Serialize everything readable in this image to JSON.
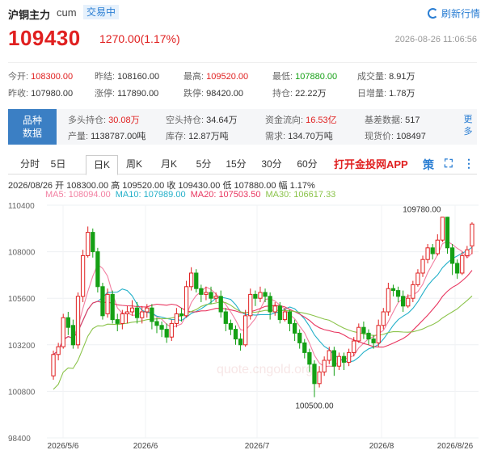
{
  "header": {
    "title": "沪铜主力",
    "code": "cum",
    "status": "交易中",
    "refresh_label": "刷新行情"
  },
  "quote": {
    "price": "109430",
    "change": "1270.00(1.17%)",
    "timestamp": "2026-08-26 11:06:56"
  },
  "stats": {
    "row1": [
      {
        "label": "今开:",
        "value": "108300.00",
        "tone": "red"
      },
      {
        "label": "昨结:",
        "value": "108160.00",
        "tone": "dark"
      },
      {
        "label": "最高:",
        "value": "109520.00",
        "tone": "red"
      },
      {
        "label": "最低:",
        "value": "107880.00",
        "tone": "green"
      },
      {
        "label": "成交量:",
        "value": "8.91万",
        "tone": "dark"
      }
    ],
    "row2": [
      {
        "label": "昨收:",
        "value": "107980.00",
        "tone": "dark"
      },
      {
        "label": "涨停:",
        "value": "117890.00",
        "tone": "dark"
      },
      {
        "label": "跌停:",
        "value": "98420.00",
        "tone": "dark"
      },
      {
        "label": "持仓:",
        "value": "22.22万",
        "tone": "dark"
      },
      {
        "label": "日增量:",
        "value": "1.78万",
        "tone": "dark"
      }
    ]
  },
  "info": {
    "variety_label_1": "品种",
    "variety_label_2": "数据",
    "row1": [
      {
        "label": "多头持仓:",
        "value": "30.08万",
        "tone": "red"
      },
      {
        "label": "空头持仓:",
        "value": "34.64万",
        "tone": "dark"
      },
      {
        "label": "资金流向:",
        "value": "16.53亿",
        "tone": "red"
      },
      {
        "label": "基差数据:",
        "value": "517",
        "tone": "dark"
      }
    ],
    "row2": [
      {
        "label": "产量:",
        "value": "1138787.00吨",
        "tone": "dark"
      },
      {
        "label": "库存:",
        "value": "12.87万吨",
        "tone": "dark"
      },
      {
        "label": "需求:",
        "value": "134.70万吨",
        "tone": "dark"
      },
      {
        "label": "现货价:",
        "value": "108497",
        "tone": "dark"
      }
    ],
    "more_label_1": "更",
    "more_label_2": "多"
  },
  "tabs": [
    "分时",
    "5日",
    "日K",
    "周K",
    "月K",
    "5分",
    "15分",
    "30分",
    "60分"
  ],
  "active_tab": "日K",
  "app_link": "打开金投网APP",
  "ohlc": "2026/08/26  开 108300.00  高 109520.00  收 109430.00  低 107880.00  幅 1.17%",
  "ma": [
    {
      "label": "MA5: 108094.00",
      "color": "#f27fa1"
    },
    {
      "label": "MA10: 107989.00",
      "color": "#23b0c9"
    },
    {
      "label": "MA20: 107503.50",
      "color": "#e8355f"
    },
    {
      "label": "MA30: 106617.33",
      "color": "#8bc34a"
    }
  ],
  "watermark": "quote.cngold.org",
  "chart_data": {
    "type": "candlestick",
    "y_ticks": [
      "110400",
      "108000",
      "105600",
      "103200",
      "100800",
      "98400"
    ],
    "ylim": [
      98400,
      110400
    ],
    "x_ticks": [
      "2026/5/6",
      "2026/6",
      "2026/7",
      "2026/8",
      "2026/8/26"
    ],
    "annotations": [
      "109780.00",
      "100500.00"
    ],
    "colors": {
      "up": "#e02020",
      "down": "#15a015"
    },
    "candles": [
      [
        101600,
        102700,
        101400,
        102900
      ],
      [
        102700,
        103100,
        102400,
        103300
      ],
      [
        103100,
        104600,
        103000,
        104800
      ],
      [
        104600,
        104100,
        103700,
        104900
      ],
      [
        104200,
        103200,
        103000,
        104500
      ],
      [
        103200,
        105700,
        103000,
        105900
      ],
      [
        105700,
        107800,
        105400,
        108100
      ],
      [
        107800,
        109000,
        107700,
        109300
      ],
      [
        109000,
        108000,
        107700,
        109200
      ],
      [
        108000,
        106200,
        105900,
        108200
      ],
      [
        106200,
        104700,
        104500,
        106400
      ],
      [
        104800,
        105800,
        104600,
        106100
      ],
      [
        105800,
        104500,
        104300,
        106000
      ],
      [
        104500,
        104300,
        103900,
        104800
      ],
      [
        104300,
        104800,
        104000,
        105000
      ],
      [
        104800,
        104900,
        104300,
        105200
      ],
      [
        104900,
        105100,
        104700,
        105500
      ],
      [
        105100,
        104600,
        104300,
        105400
      ],
      [
        104600,
        104900,
        104300,
        105200
      ],
      [
        104900,
        105100,
        104600,
        105300
      ],
      [
        105100,
        104400,
        104000,
        105300
      ],
      [
        104400,
        104200,
        103800,
        104600
      ],
      [
        104200,
        104000,
        103600,
        104400
      ],
      [
        104000,
        103600,
        103300,
        104300
      ],
      [
        103600,
        104300,
        103400,
        104500
      ],
      [
        104300,
        104800,
        104100,
        105100
      ],
      [
        104800,
        104700,
        104400,
        105100
      ],
      [
        104700,
        106200,
        104600,
        106500
      ],
      [
        106200,
        106900,
        106000,
        107200
      ],
      [
        106900,
        106100,
        105900,
        107100
      ],
      [
        106100,
        105800,
        105400,
        106300
      ],
      [
        105800,
        105900,
        105500,
        106200
      ],
      [
        105900,
        105600,
        105300,
        106200
      ],
      [
        105600,
        105700,
        105400,
        105900
      ],
      [
        105700,
        104900,
        104600,
        106000
      ],
      [
        104900,
        104300,
        103900,
        105100
      ],
      [
        104300,
        104000,
        103700,
        104500
      ],
      [
        104000,
        103500,
        103200,
        104200
      ],
      [
        103500,
        103200,
        102900,
        103800
      ],
      [
        103200,
        104700,
        103100,
        105000
      ],
      [
        104700,
        105800,
        104500,
        106100
      ],
      [
        105800,
        105600,
        105200,
        106000
      ],
      [
        105600,
        105900,
        105400,
        106200
      ],
      [
        105900,
        105700,
        105400,
        106100
      ],
      [
        105700,
        104900,
        104500,
        105900
      ],
      [
        104900,
        105200,
        104700,
        105400
      ],
      [
        105200,
        104500,
        104300,
        105400
      ],
      [
        104500,
        104900,
        104400,
        105100
      ],
      [
        104900,
        104300,
        103900,
        105000
      ],
      [
        104300,
        103800,
        103400,
        104500
      ],
      [
        103800,
        103300,
        103000,
        104000
      ],
      [
        103300,
        102800,
        102500,
        103500
      ],
      [
        102800,
        102200,
        101800,
        103000
      ],
      [
        102200,
        101200,
        100500,
        102400
      ],
      [
        101200,
        101800,
        101000,
        102100
      ],
      [
        101800,
        102400,
        101600,
        102600
      ],
      [
        102400,
        102900,
        102200,
        103100
      ],
      [
        102900,
        102100,
        101600,
        103100
      ],
      [
        102100,
        102600,
        101900,
        102800
      ],
      [
        102600,
        102300,
        101900,
        102800
      ],
      [
        102300,
        102800,
        102100,
        103000
      ],
      [
        102800,
        103400,
        102600,
        103600
      ],
      [
        103400,
        104100,
        103300,
        104300
      ],
      [
        104100,
        103800,
        103500,
        104400
      ],
      [
        103800,
        103500,
        103200,
        104000
      ],
      [
        103500,
        103300,
        103000,
        103700
      ],
      [
        103300,
        104200,
        103100,
        104500
      ],
      [
        104200,
        104900,
        104000,
        105100
      ],
      [
        104900,
        106100,
        104700,
        106400
      ],
      [
        106100,
        106000,
        105700,
        106300
      ],
      [
        106000,
        105700,
        105400,
        106200
      ],
      [
        105700,
        105200,
        104900,
        106000
      ],
      [
        105200,
        105600,
        105100,
        105800
      ],
      [
        105600,
        106300,
        105400,
        106500
      ],
      [
        106300,
        106900,
        106200,
        107100
      ],
      [
        106900,
        107600,
        106700,
        107800
      ],
      [
        107600,
        108200,
        107400,
        108400
      ],
      [
        108200,
        107900,
        107600,
        108400
      ],
      [
        107900,
        108600,
        107800,
        108900
      ],
      [
        108600,
        109780,
        108500,
        109780
      ],
      [
        109780,
        108200,
        107900,
        109800
      ],
      [
        108200,
        107400,
        106800,
        108400
      ],
      [
        107400,
        106900,
        106600,
        107600
      ],
      [
        106900,
        107800,
        106800,
        108000
      ],
      [
        107800,
        108100,
        107700,
        108300
      ],
      [
        108300,
        109430,
        107880,
        109520
      ]
    ]
  }
}
